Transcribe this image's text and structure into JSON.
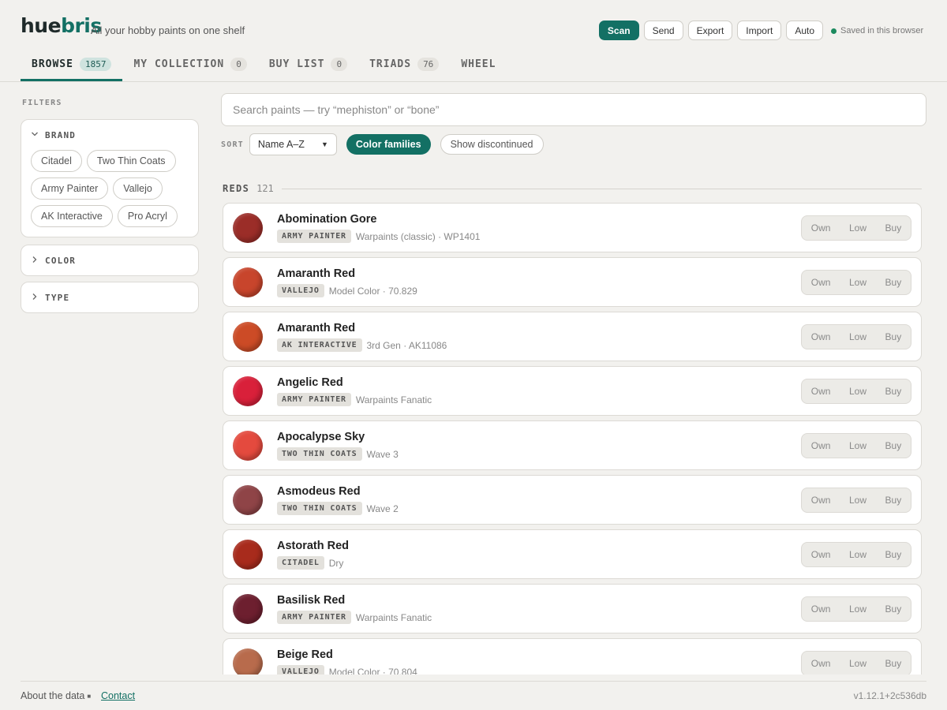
{
  "app": {
    "logo_main": "hue",
    "logo_accent": "bris",
    "tagline": "All your hobby paints on one shelf"
  },
  "header": {
    "buttons": [
      {
        "label": "Scan",
        "primary": true
      },
      {
        "label": "Send"
      },
      {
        "label": "Export"
      },
      {
        "label": "Import"
      },
      {
        "label": "Auto"
      }
    ],
    "saved_status": "Saved in this browser"
  },
  "tabs": [
    {
      "label": "BROWSE",
      "count": "1857",
      "active": true
    },
    {
      "label": "MY COLLECTION",
      "count": "0"
    },
    {
      "label": "BUY LIST",
      "count": "0"
    },
    {
      "label": "TRIADS",
      "count": "76"
    },
    {
      "label": "WHEEL",
      "count": ""
    }
  ],
  "sidebar": {
    "filters_label": "FILTERS",
    "brand": {
      "title": "BRAND",
      "chips": [
        "Citadel",
        "Two Thin Coats",
        "Army Painter",
        "Vallejo",
        "AK Interactive",
        "Pro Acryl"
      ]
    },
    "color": {
      "title": "COLOR"
    },
    "type": {
      "title": "TYPE"
    }
  },
  "main": {
    "search_placeholder": "Search paints — try “mephiston” or “bone”",
    "sort_label": "SORT",
    "sort_value": "Name A–Z",
    "color_families_label": "Color families",
    "show_discontinued_label": "Show discontinued",
    "group": {
      "name": "REDS",
      "count": "121"
    },
    "actions": [
      "Own",
      "Low",
      "Buy"
    ],
    "paints": [
      {
        "name": "Abomination Gore",
        "brand": "ARMY PAINTER",
        "range": "Warpaints (classic) · WP1401",
        "color": "#9b2d28"
      },
      {
        "name": "Amaranth Red",
        "brand": "VALLEJO",
        "range": "Model Color · 70.829",
        "color": "#c8452c"
      },
      {
        "name": "Amaranth Red",
        "brand": "AK INTERACTIVE",
        "range": "3rd Gen · AK11086",
        "color": "#cc4b26"
      },
      {
        "name": "Angelic Red",
        "brand": "ARMY PAINTER",
        "range": "Warpaints Fanatic",
        "color": "#d9203a"
      },
      {
        "name": "Apocalypse Sky",
        "brand": "TWO THIN COATS",
        "range": "Wave 3",
        "color": "#e44a3e"
      },
      {
        "name": "Asmodeus Red",
        "brand": "TWO THIN COATS",
        "range": "Wave 2",
        "color": "#8f4447"
      },
      {
        "name": "Astorath Red",
        "brand": "CITADEL",
        "range": "Dry",
        "color": "#a82b1c"
      },
      {
        "name": "Basilisk Red",
        "brand": "ARMY PAINTER",
        "range": "Warpaints Fanatic",
        "color": "#6d1f2f"
      },
      {
        "name": "Beige Red",
        "brand": "VALLEJO",
        "range": "Model Color · 70.804",
        "color": "#b86b4c"
      }
    ]
  },
  "footer": {
    "about": "About the data",
    "contact": "Contact",
    "version": "v1.12.1+2c536db"
  }
}
